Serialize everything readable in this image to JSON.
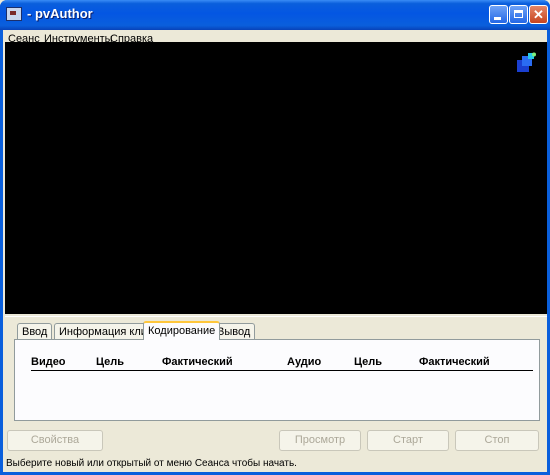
{
  "window": {
    "title": "- pvAuthor"
  },
  "menu": {
    "items": [
      "Сеанс",
      "Инструменты",
      "Справка"
    ]
  },
  "tabs": [
    "Ввод",
    "Информация клипа",
    "Кодирование",
    "Вывод"
  ],
  "active_tab": "Кодирование",
  "encoding_table": {
    "columns": [
      "Видео",
      "Цель",
      "Фактический",
      "Аудио",
      "Цель",
      "Фактический"
    ]
  },
  "buttons": {
    "properties": "Свойства",
    "preview": "Просмотр",
    "start": "Старт",
    "stop": "Стоп"
  },
  "status": {
    "text": "Выберите новый или открытый от меню Сеанса чтобы начать."
  },
  "colors": {
    "video_bg": "#000000",
    "titlebar": "#0a5fdc"
  }
}
